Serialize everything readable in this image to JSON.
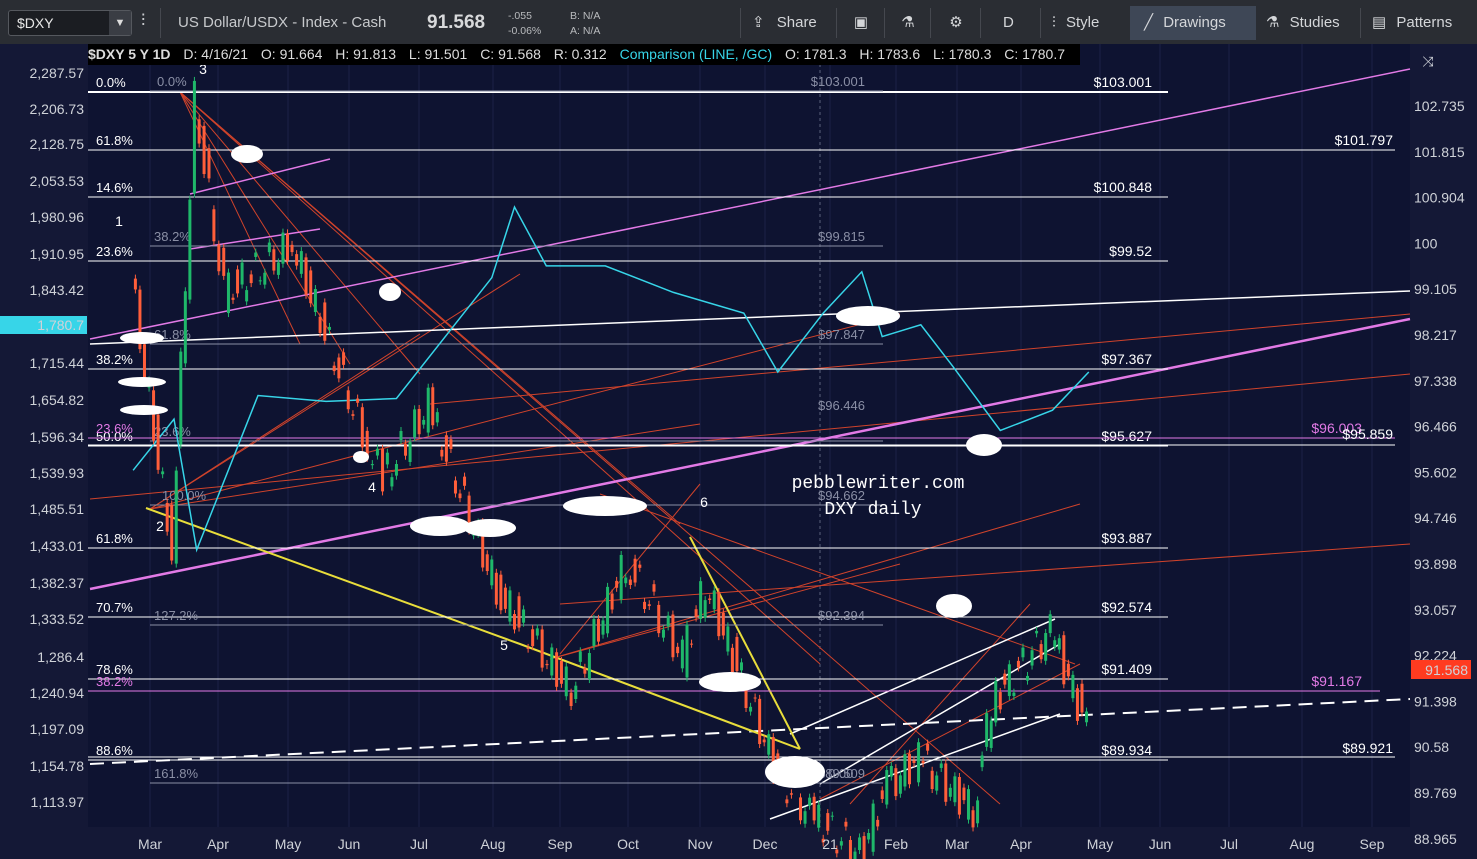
{
  "toolbar": {
    "symbol": "$DXY",
    "description": "US Dollar/USDX - Index - Cash",
    "last": "91.568",
    "change": "-.055",
    "change_pct": "-0.06%",
    "bid": "B: N/A",
    "ask": "A: N/A",
    "share": "Share",
    "period_code": "D",
    "style": "Style",
    "drawings": "Drawings",
    "studies": "Studies",
    "patterns": "Patterns"
  },
  "infobar": {
    "symbol": "$DXY 5 Y 1D",
    "date": "D: 4/16/21",
    "open": "O: 91.664",
    "high": "H: 91.813",
    "low": "L: 91.501",
    "close": "C: 91.568",
    "range": "R: 0.312",
    "comparison": "Comparison (LINE, /GC)",
    "cmp_open": "O: 1781.3",
    "cmp_high": "H: 1783.6",
    "cmp_low": "L: 1780.3",
    "cmp_close": "C: 1780.7"
  },
  "colors": {
    "background": "#0e1331",
    "comparison_line": "#37d5e8",
    "up_candle": "#1fb86a",
    "down_candle": "#ff5e3a",
    "magenta_channel": "#e27ae6",
    "red_fan": "#d0432b",
    "yellow_trend": "#e8dd3b",
    "price_badge": "#ff3b20"
  },
  "chart_data": {
    "type": "line",
    "title": "DXY daily",
    "watermark": "pebblewriter.com",
    "xlabel": "",
    "ylabel": "",
    "x_ticks": [
      "Mar",
      "Apr",
      "May",
      "Jun",
      "Jul",
      "Aug",
      "Sep",
      "Oct",
      "Nov",
      "Dec",
      "21",
      "Feb",
      "Mar",
      "Apr",
      "May",
      "Jun",
      "Jul",
      "Aug",
      "Sep"
    ],
    "y_right_ticks": [
      "102.735",
      "101.815",
      "100.904",
      "100",
      "99.105",
      "98.217",
      "97.338",
      "96.466",
      "95.602",
      "94.746",
      "93.898",
      "93.057",
      "92.224",
      "91.398",
      "90.58",
      "89.769",
      "88.965"
    ],
    "y_left_ticks": [
      "2,287.57",
      "2,206.73",
      "2,128.75",
      "2,053.53",
      "1,980.96",
      "1,910.95",
      "1,843.42",
      "1,715.44",
      "1,654.82",
      "1,596.34",
      "1,539.93",
      "1,485.51",
      "1,433.01",
      "1,382.37",
      "1,333.52",
      "1,286.4",
      "1,240.94",
      "1,197.09",
      "1,154.78",
      "1,113.97"
    ],
    "y_left_current": "1,780.7",
    "y_right_current": "91.568",
    "ylim_right": [
      88.965,
      102.735
    ],
    "series": [
      {
        "name": "$DXY",
        "style": "candles",
        "x": [
          "2020-02-20",
          "2020-03-09",
          "2020-03-19",
          "2020-04-01",
          "2020-05-01",
          "2020-06-01",
          "2020-06-10",
          "2020-06-30",
          "2020-07-30",
          "2020-08-15",
          "2020-09-01",
          "2020-09-25",
          "2020-10-20",
          "2020-10-30",
          "2020-11-15",
          "2020-12-01",
          "2020-12-15",
          "2021-01-06",
          "2021-01-18",
          "2021-02-01",
          "2021-02-25",
          "2021-03-05",
          "2021-03-31",
          "2021-04-16"
        ],
        "values": [
          99.6,
          94.7,
          102.8,
          99.3,
          100.2,
          96.8,
          96.0,
          97.3,
          94.0,
          93.1,
          92.2,
          94.5,
          92.8,
          94.1,
          92.4,
          90.7,
          90.0,
          89.3,
          90.5,
          91.0,
          90.1,
          92.0,
          93.3,
          91.57
        ]
      },
      {
        "name": "/GC",
        "style": "line",
        "x": [
          "2020-02-20",
          "2020-03-09",
          "2020-03-19",
          "2020-04-15",
          "2020-05-15",
          "2020-06-15",
          "2020-07-27",
          "2020-08-06",
          "2020-08-20",
          "2020-09-15",
          "2020-10-15",
          "2020-11-15",
          "2020-11-30",
          "2020-12-20",
          "2021-01-06",
          "2021-01-15",
          "2021-02-01",
          "2021-02-15",
          "2021-03-08",
          "2021-03-31",
          "2021-04-16"
        ],
        "values": [
          1610,
          1700,
          1470,
          1740,
          1730,
          1735,
          1940,
          2060,
          1960,
          1960,
          1915,
          1880,
          1780,
          1880,
          1950,
          1840,
          1860,
          1790,
          1680,
          1715,
          1780
        ]
      }
    ],
    "fib_levels": [
      {
        "pct": "0.0%",
        "level": "$103.001"
      },
      {
        "pct": "61.8%",
        "level": "$101.797"
      },
      {
        "pct": "14.6%",
        "level": "$100.848"
      },
      {
        "pct": "23.6%",
        "level": "$99.52"
      },
      {
        "pct": "38.2%",
        "level": "$97.367"
      },
      {
        "pct": "50.0%",
        "level": "$95.627"
      },
      {
        "pct": "61.8%",
        "level": "$93.887"
      },
      {
        "pct": "70.7%",
        "level": "$92.574"
      },
      {
        "pct": "78.6%",
        "level": "$91.409"
      },
      {
        "pct": "88.6%",
        "level": "$89.934"
      }
    ],
    "magenta_levels": [
      {
        "pct": "23.6%",
        "level": "$96.003"
      },
      {
        "pct": "38.2%",
        "level": "$91.167"
      },
      {
        "pct": "",
        "level": "$95.859"
      },
      {
        "pct": "",
        "level": "$89.921"
      }
    ],
    "gray_fib_labels": [
      "0.0%",
      "38.2%",
      "61.8%",
      "23.6%",
      "100.0%",
      "127.2%",
      "161.8%",
      "$103.001",
      "$99.815",
      "$97.847",
      "$96.446",
      "$94.662",
      "$92.394",
      "$89.509",
      "0.00"
    ],
    "wave_labels": [
      "1",
      "2",
      "3",
      "4",
      "5",
      "6"
    ]
  }
}
